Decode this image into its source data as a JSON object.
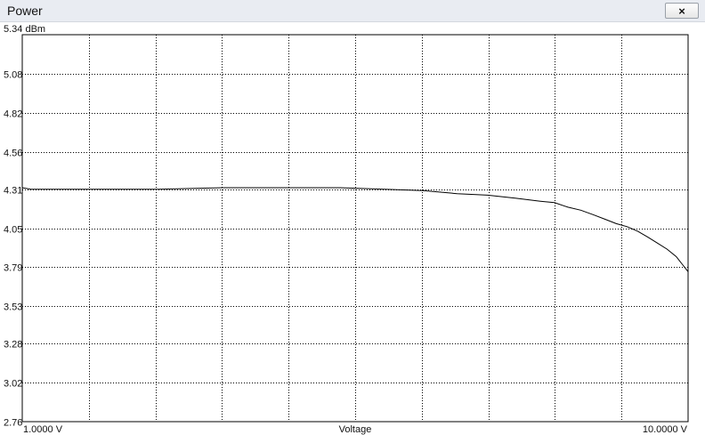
{
  "window": {
    "title": "Power",
    "close_glyph": "×",
    "close_icon": "close-icon"
  },
  "chart_data": {
    "type": "line",
    "title": "",
    "xlabel": "Voltage",
    "ylabel": "",
    "x_scale": "log",
    "xlim": [
      1,
      10
    ],
    "ylim": [
      2.76,
      5.34
    ],
    "x_tick_labels": [
      "1.0000 V",
      "10.0000 V"
    ],
    "y_tick_labels": [
      "5.34 dBm",
      "5.08",
      "4.82",
      "4.56",
      "4.31",
      "4.05",
      "3.79",
      "3.53",
      "3.28",
      "3.02",
      "2.76"
    ],
    "y_ticks": [
      5.34,
      5.08,
      4.82,
      4.56,
      4.31,
      4.05,
      3.79,
      3.53,
      3.28,
      3.02,
      2.76
    ],
    "grid": true,
    "line_color": "#000000",
    "series": [
      {
        "x": [
          1.0,
          1.03,
          1.1,
          1.3,
          1.6,
          2.0,
          2.5,
          3.0,
          3.5,
          4.0,
          4.5,
          5.0,
          5.5,
          6.0,
          6.3,
          6.6,
          6.9,
          7.2,
          7.5,
          7.8,
          8.1,
          8.4,
          8.7,
          9.0,
          9.3,
          9.6,
          9.8,
          10.0
        ],
        "y": [
          4.32,
          4.31,
          4.31,
          4.31,
          4.31,
          4.32,
          4.32,
          4.32,
          4.31,
          4.3,
          4.28,
          4.27,
          4.25,
          4.23,
          4.22,
          4.19,
          4.17,
          4.14,
          4.11,
          4.08,
          4.06,
          4.03,
          3.99,
          3.95,
          3.91,
          3.86,
          3.81,
          3.76
        ]
      }
    ]
  }
}
